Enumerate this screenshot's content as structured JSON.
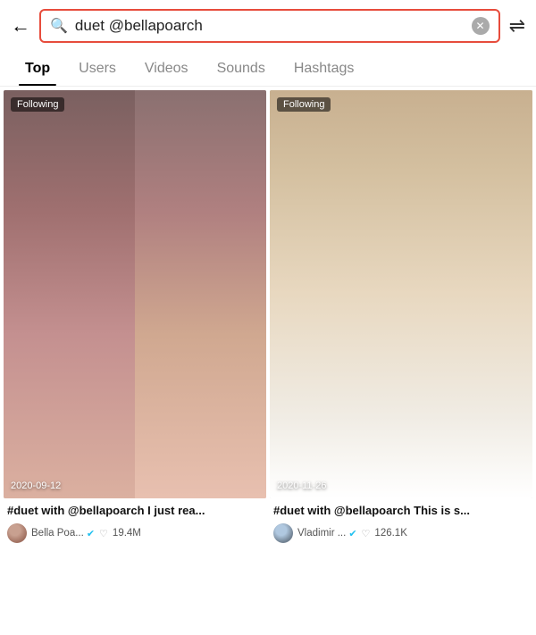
{
  "header": {
    "back_label": "←",
    "search_value": "duet @bellapoarch",
    "clear_label": "✕",
    "filter_label": "⇌"
  },
  "tabs": {
    "items": [
      {
        "id": "top",
        "label": "Top",
        "active": true
      },
      {
        "id": "users",
        "label": "Users",
        "active": false
      },
      {
        "id": "videos",
        "label": "Videos",
        "active": false
      },
      {
        "id": "sounds",
        "label": "Sounds",
        "active": false
      },
      {
        "id": "hashtags",
        "label": "Hashtags",
        "active": false
      }
    ]
  },
  "cards": [
    {
      "following": "Following",
      "date": "2020-09-12",
      "title": "#duet with @bellapoarch I just rea...",
      "author": "Bella Poa...",
      "verified": true,
      "likes": "19.4M"
    },
    {
      "following": "Following",
      "date": "2020-11-26",
      "title": "#duet with @bellapoarch This is s...",
      "author": "Vladimir ...",
      "verified": true,
      "likes": "126.1K"
    }
  ]
}
